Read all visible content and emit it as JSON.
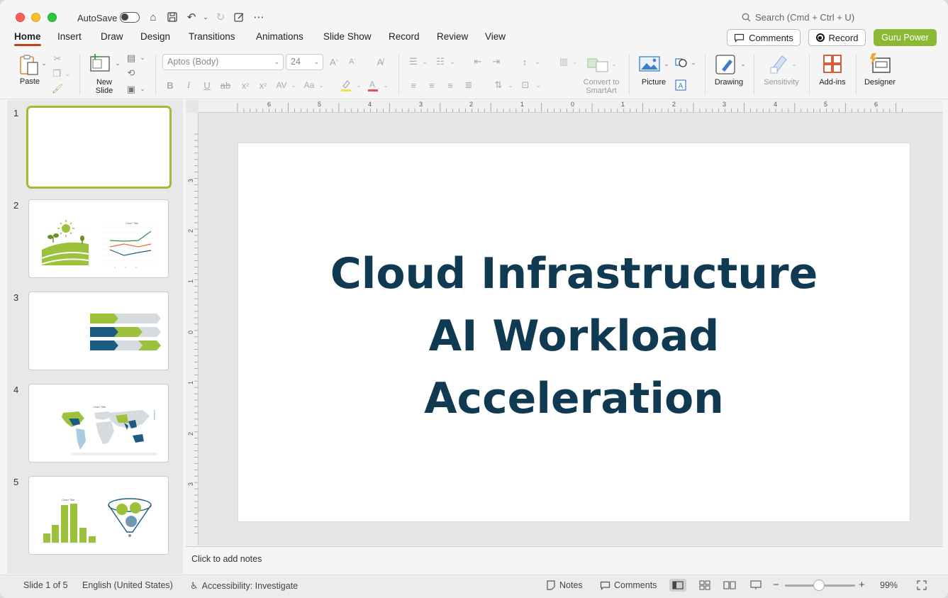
{
  "titlebar": {
    "autosave_label": "AutoSave",
    "search_placeholder": "Search (Cmd + Ctrl + U)"
  },
  "tabs": [
    {
      "label": "Home"
    },
    {
      "label": "Insert"
    },
    {
      "label": "Draw"
    },
    {
      "label": "Design"
    },
    {
      "label": "Transitions"
    },
    {
      "label": "Animations"
    },
    {
      "label": "Slide Show"
    },
    {
      "label": "Record"
    },
    {
      "label": "Review"
    },
    {
      "label": "View"
    }
  ],
  "header_buttons": {
    "comments": "Comments",
    "record": "Record",
    "guru": "Guru Power"
  },
  "ribbon": {
    "paste": "Paste",
    "new_slide_1": "New",
    "new_slide_2": "Slide",
    "font_name": "Aptos (Body)",
    "font_size": "24",
    "convert_1": "Convert to",
    "convert_2": "SmartArt",
    "picture": "Picture",
    "drawing": "Drawing",
    "sensitivity": "Sensitivity",
    "addins": "Add-ins",
    "designer": "Designer"
  },
  "thumbnails": [
    {
      "num": "1"
    },
    {
      "num": "2"
    },
    {
      "num": "3"
    },
    {
      "num": "4"
    },
    {
      "num": "5"
    }
  ],
  "slide": {
    "title_line1": "Cloud Infrastructure",
    "title_line2": "AI Workload",
    "title_line3": "Acceleration"
  },
  "notes_placeholder": "Click to add notes",
  "statusbar": {
    "slide_count": "Slide 1 of 5",
    "language": "English (United States)",
    "accessibility": "Accessibility: Investigate",
    "notes": "Notes",
    "comments": "Comments",
    "zoom": "99%"
  },
  "colors": {
    "accent_tab": "#c43e1c",
    "guru_green": "#8cb933",
    "title_navy": "#0f3a52",
    "selected_border": "#a6b935"
  }
}
